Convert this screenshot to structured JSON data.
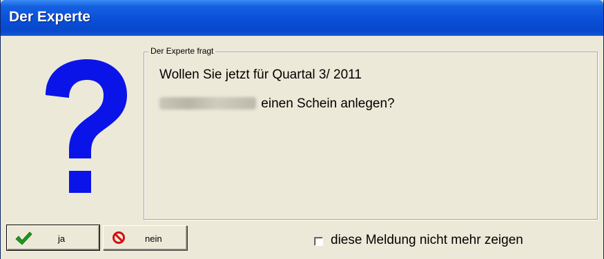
{
  "window": {
    "title": "Der Experte"
  },
  "icon": {
    "name": "question-mark-icon",
    "color": "#0a14e8"
  },
  "group": {
    "legend": "Der Experte fragt",
    "message_line1": "Wollen Sie jetzt für Quartal 3/ 2011",
    "message_line2_name_redacted": "Hellmut Kühn",
    "message_line2_suffix": "einen Schein anlegen?"
  },
  "buttons": {
    "yes_label": "ja",
    "yes_icon": "check-icon",
    "no_label": "nein",
    "no_icon": "no-entry-icon"
  },
  "checkbox": {
    "label": "diese Meldung nicht mehr zeigen",
    "checked": false
  },
  "colors": {
    "titlebar": "#0a4fd8",
    "dialog_bg": "#ece9d8",
    "check_green": "#1a9c1a",
    "no_red": "#d01010"
  }
}
